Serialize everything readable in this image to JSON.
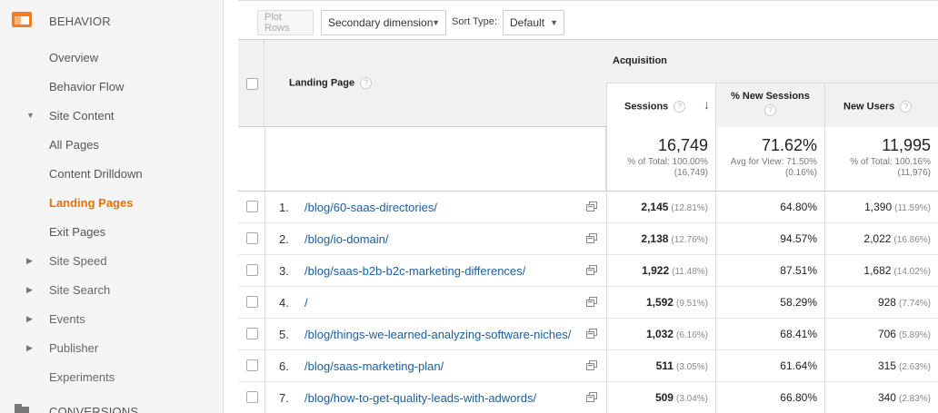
{
  "sidebar": {
    "behavior_label": "BEHAVIOR",
    "conversions_label": "CONVERSIONS",
    "items": [
      {
        "label": "Overview"
      },
      {
        "label": "Behavior Flow"
      },
      {
        "label": "Site Content"
      },
      {
        "label": "All Pages"
      },
      {
        "label": "Content Drilldown"
      },
      {
        "label": "Landing Pages"
      },
      {
        "label": "Exit Pages"
      },
      {
        "label": "Site Speed"
      },
      {
        "label": "Site Search"
      },
      {
        "label": "Events"
      },
      {
        "label": "Publisher"
      },
      {
        "label": "Experiments"
      }
    ]
  },
  "toolbar": {
    "plot_rows": "Plot Rows",
    "secondary_dimension": "Secondary dimension",
    "sort_type_label": "Sort Type:",
    "sort_type_value": "Default"
  },
  "table": {
    "group_header": "Acquisition",
    "landing_page_header": "Landing Page",
    "columns": {
      "sessions": "Sessions",
      "new_sessions": "% New Sessions",
      "new_users": "New Users"
    },
    "totals": {
      "sessions": "16,749",
      "sessions_sub1": "% of Total: 100.00%",
      "sessions_sub2": "(16,749)",
      "new_sessions": "71.62%",
      "new_sessions_sub1": "Avg for View: 71.50%",
      "new_sessions_sub2": "(0.16%)",
      "new_users": "11,995",
      "new_users_sub1": "% of Total: 100.16%",
      "new_users_sub2": "(11,976)"
    },
    "rows": [
      {
        "n": "1.",
        "page": "/blog/60-saas-directories/",
        "sessions": "2,145",
        "sessions_pct": "(12.81%)",
        "new_sessions": "64.80%",
        "new_users": "1,390",
        "new_users_pct": "(11.59%)"
      },
      {
        "n": "2.",
        "page": "/blog/io-domain/",
        "sessions": "2,138",
        "sessions_pct": "(12.76%)",
        "new_sessions": "94.57%",
        "new_users": "2,022",
        "new_users_pct": "(16.86%)"
      },
      {
        "n": "3.",
        "page": "/blog/saas-b2b-b2c-marketing-differences/",
        "sessions": "1,922",
        "sessions_pct": "(11.48%)",
        "new_sessions": "87.51%",
        "new_users": "1,682",
        "new_users_pct": "(14.02%)"
      },
      {
        "n": "4.",
        "page": "/",
        "sessions": "1,592",
        "sessions_pct": "(9.51%)",
        "new_sessions": "58.29%",
        "new_users": "928",
        "new_users_pct": "(7.74%)"
      },
      {
        "n": "5.",
        "page": "/blog/things-we-learned-analyzing-software-niches/",
        "sessions": "1,032",
        "sessions_pct": "(6.16%)",
        "new_sessions": "68.41%",
        "new_users": "706",
        "new_users_pct": "(5.89%)"
      },
      {
        "n": "6.",
        "page": "/blog/saas-marketing-plan/",
        "sessions": "511",
        "sessions_pct": "(3.05%)",
        "new_sessions": "61.64%",
        "new_users": "315",
        "new_users_pct": "(2.63%)"
      },
      {
        "n": "7.",
        "page": "/blog/how-to-get-quality-leads-with-adwords/",
        "sessions": "509",
        "sessions_pct": "(3.04%)",
        "new_sessions": "66.80%",
        "new_users": "340",
        "new_users_pct": "(2.83%)"
      }
    ]
  },
  "colors": {
    "accent": "#e8710a",
    "link": "#1a5fa0"
  }
}
